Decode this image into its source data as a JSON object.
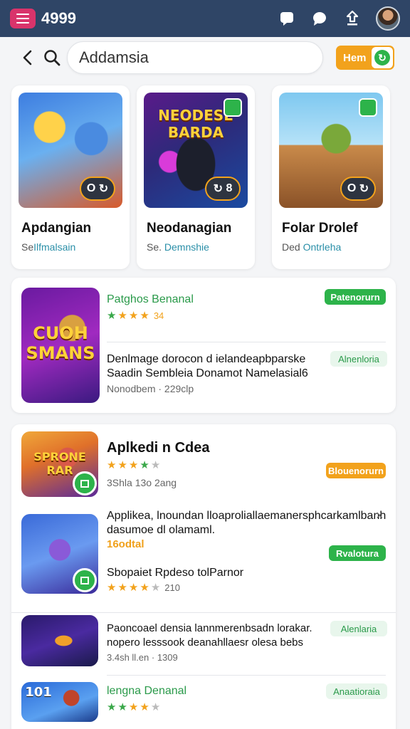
{
  "topbar": {
    "brand": "4999",
    "icons": [
      "menu-icon",
      "chat-icon",
      "speech-bubble-icon",
      "share-icon",
      "avatar"
    ]
  },
  "search": {
    "value": "Addamsia",
    "toggle_label": "Hem"
  },
  "featured": [
    {
      "title": "Apdangian",
      "sub_prefix": "Se",
      "sub_accent": "Ilfmalsain",
      "badge": "O",
      "thumb_text": ""
    },
    {
      "title": "Neodanagian",
      "sub_prefix": "Se.",
      "sub_accent": "Demnshie",
      "badge": "8",
      "thumb_text": "NEODESE BARDA"
    },
    {
      "title": "Folar Drolef",
      "sub_prefix": "Ded",
      "sub_accent": "Ontrleha",
      "badge": "O",
      "thumb_text": ""
    }
  ],
  "panel1": {
    "thumb_text": "CUOH SMANS",
    "title": "Patghos Benanal",
    "rating_count": "34",
    "badge": "Patenorurn",
    "desc_line1": "Denlmage dorocon d ielandeapbparske",
    "desc_line2": "Saadin Sembleia Donamot Namelasial6",
    "meta": "Nonodbem · 229clp",
    "side_tag": "Alnenloria"
  },
  "panel2": {
    "item1": {
      "thumb_text": "SPRONE RAR",
      "title": "Aplkedi n Cdea",
      "meta": "3Shla 13o 2ang",
      "badge": "Blouenorurn"
    },
    "item2": {
      "desc_line1": "Applikea, lnoundan lloaproliallaemanersphcarkamlbanh",
      "desc_line2": "dasumoe dl olamaml.",
      "orange_line": "16odtal",
      "badge": "Rvalotura",
      "title": "Sbopaiet Rpdeso tolParnor",
      "rating_count": "210",
      "close": "×"
    },
    "item3": {
      "desc_line1": "Paoncoael densia lannmerenbsadn lorakar.",
      "desc_line2": "nopero lesssook deanahllaesr olesa bebs",
      "meta": "3.4sh ll.en · 1309",
      "side_tag": "Alenlaria"
    },
    "item4": {
      "thumb_text": "101",
      "title": "lengna Denanal",
      "side_tag": "Anaatioraia"
    }
  },
  "colors": {
    "topbar": "#2f4566",
    "accent_pink": "#d9346b",
    "green": "#2db34a",
    "orange": "#f2a21c",
    "teal": "#2a8fa8"
  }
}
